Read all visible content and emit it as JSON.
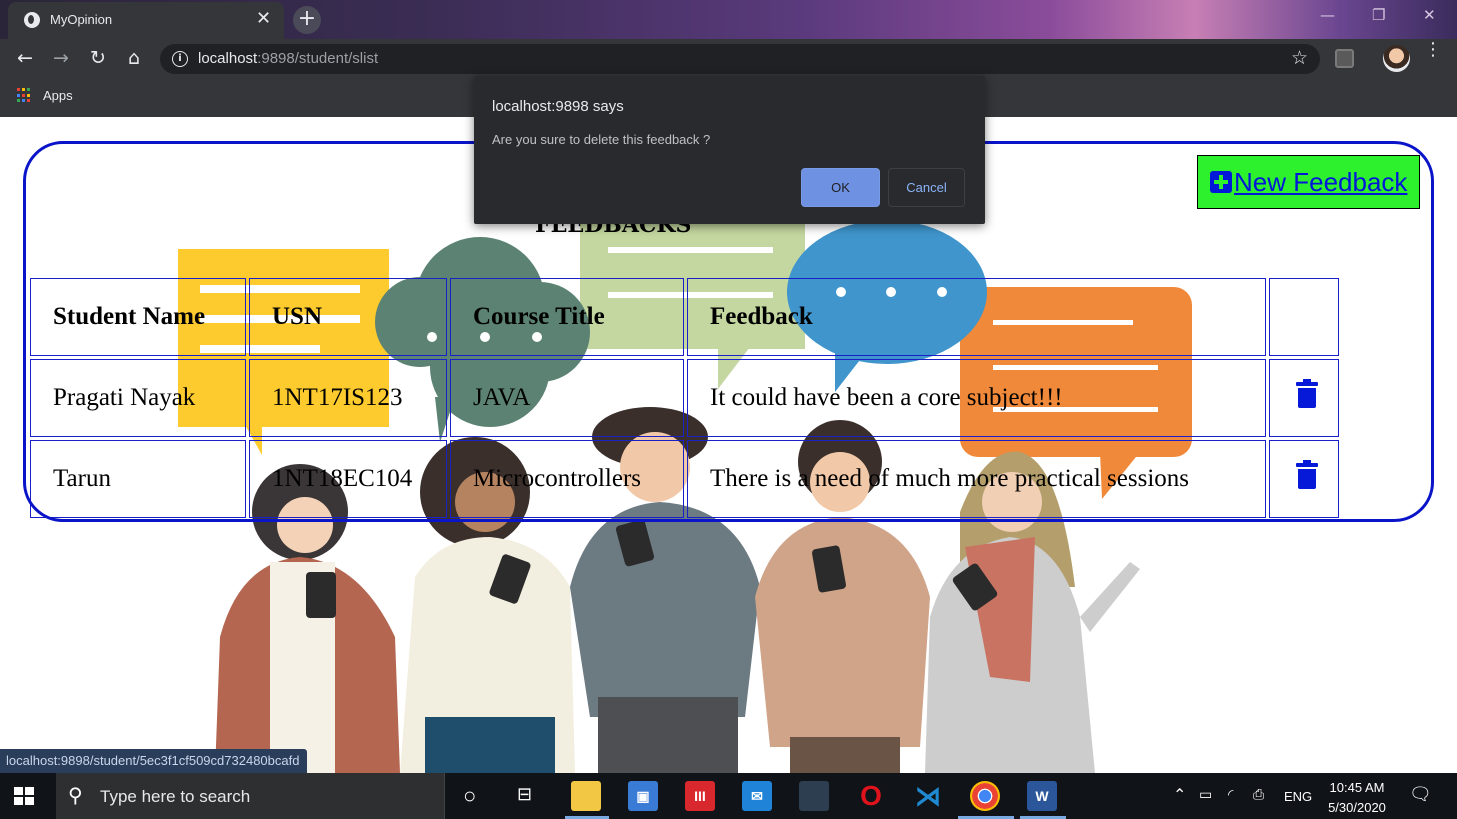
{
  "browser": {
    "tab_title": "MyOpinion",
    "tab_close": "✕",
    "new_tab": "+",
    "url_host": "localhost",
    "url_rest": ":9898/student/slist",
    "bookmarks_apps": "Apps"
  },
  "dialog": {
    "title": "localhost:9898 says",
    "message": "Are you sure to delete this feedback ?",
    "ok_label": "OK",
    "cancel_label": "Cancel"
  },
  "page": {
    "heading": "FEEDBACKS",
    "new_feedback_label": "New Feedback",
    "accent_color": "#2ef12e",
    "border_color": "#0a14c8"
  },
  "table": {
    "headers": [
      "Student Name",
      "USN",
      "Course Title",
      "Feedback",
      ""
    ],
    "rows": [
      {
        "name": "Pragati Nayak",
        "usn": "1NT17IS123",
        "course": "JAVA",
        "feedback": "It could have been a core subject!!!"
      },
      {
        "name": "Tarun",
        "usn": "1NT18EC104",
        "course": "Microcontrollers",
        "feedback": "There is a need of much more practical sessions"
      }
    ]
  },
  "status_bar": {
    "url": "localhost:9898/student/5ec3f1cf509cd732480bcafd"
  },
  "taskbar": {
    "search_placeholder": "Type here to search",
    "language": "ENG",
    "time": "10:45 AM",
    "date": "5/30/2020"
  }
}
